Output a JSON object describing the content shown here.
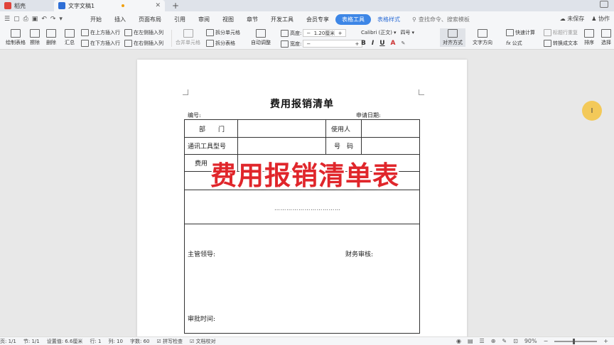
{
  "tabs": {
    "home": "稻壳",
    "document": "文字文稿1",
    "new_tab": "+"
  },
  "menu": {
    "items": [
      "开始",
      "插入",
      "页面布局",
      "引用",
      "审阅",
      "视图",
      "章节",
      "开发工具",
      "会员专享",
      "表格工具",
      "表格样式"
    ],
    "active": "表格工具",
    "search": "查找命令、搜索模板",
    "unsaved": "未保存",
    "collab": "协作"
  },
  "ribbon": {
    "draw_table": "绘制表格",
    "eraser": "擦除",
    "delete": "删除",
    "summary": "汇总",
    "insert_above": "在上方插入行",
    "insert_below": "在下方插入行",
    "insert_left": "在左侧插入列",
    "insert_right": "在右侧插入列",
    "merge_cells": "合并单元格",
    "split_cells": "拆分单元格",
    "split_table": "拆分表格",
    "auto_fit": "自动调整",
    "height_label": "高度:",
    "height_value": "1.20厘米",
    "width_label": "宽度:",
    "font_name": "Calibri (正文)",
    "font_size": "四号",
    "align": "对齐方式",
    "text_direction": "文字方向",
    "formula": "公式",
    "quick_calc": "快速计算",
    "repeat_header": "标题行重复",
    "convert_text": "转换成文本",
    "sort": "排序",
    "select": "选择"
  },
  "document": {
    "title": "费用报销清单",
    "number_label": "编号:",
    "date_label": "申请日期:",
    "dept_label": "部　　门",
    "user_label": "使用人",
    "device_label": "通讯工具型号",
    "number_field_label": "号　码",
    "fee_label": "费用",
    "dots": "……………………………",
    "manager_label": "主管领导:",
    "finance_label": "财务审核:",
    "approve_time_label": "审批时间:"
  },
  "overlay": {
    "caption": "费用报销清单表"
  },
  "status": {
    "page": "页: 1/1",
    "section": "节: 1/1",
    "setting": "设置值: 6.6厘米",
    "row": "行: 1",
    "col": "列: 10",
    "words": "字数: 60",
    "spell": "拼写检查",
    "proof": "文档校对",
    "zoom": "90%"
  },
  "colors": {
    "accent": "#3d86e6",
    "caption_red": "#e0262b",
    "cursor_highlight": "#f5c64a"
  }
}
